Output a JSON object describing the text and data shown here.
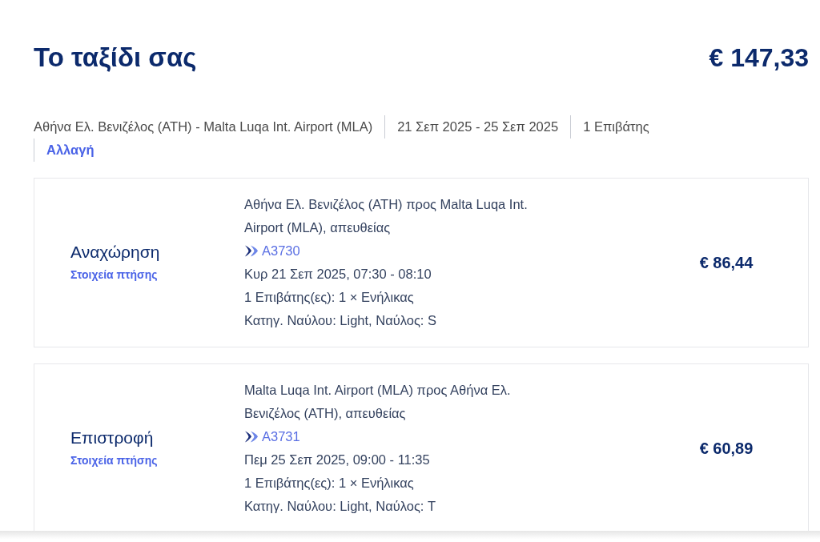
{
  "trip": {
    "title": "Το ταξίδι σας",
    "total_price": "€ 147,33"
  },
  "summary": {
    "items": [
      "Αθήνα Ελ. Βενιζέλος (ATH) - Malta Luqa Int. Airport (MLA)",
      "21 Σεπ 2025 - 25 Σεπ 2025",
      "1 Επιβάτης"
    ],
    "change_link": "Αλλαγή"
  },
  "flights": [
    {
      "direction": "Αναχώρηση",
      "details_link": "Στοιχεία πτήσης",
      "route": "Αθήνα Ελ. Βενιζέλος (ATH) προς Malta Luqa Int. Airport (MLA), απευθείας",
      "flight_number": "A3730",
      "schedule": "Κυρ 21 Σεπ 2025, 07:30 - 08:10",
      "passengers": "1 Επιβάτης(ες): 1 × Ενήλικας",
      "fare": "Κατηγ. Ναύλου: Light, Ναύλος: S",
      "price": "€ 86,44"
    },
    {
      "direction": "Επιστροφή",
      "details_link": "Στοιχεία πτήσης",
      "route": "Malta Luqa Int. Airport (MLA) προς Αθήνα Ελ. Βενιζέλος (ATH), απευθείας",
      "flight_number": "A3731",
      "schedule": "Πεμ 25 Σεπ 2025, 09:00 - 11:35",
      "passengers": "1 Επιβάτης(ες): 1 × Ενήλικας",
      "fare": "Κατηγ. Ναύλου: Light, Ναύλος: T",
      "price": "€ 60,89"
    }
  ]
}
